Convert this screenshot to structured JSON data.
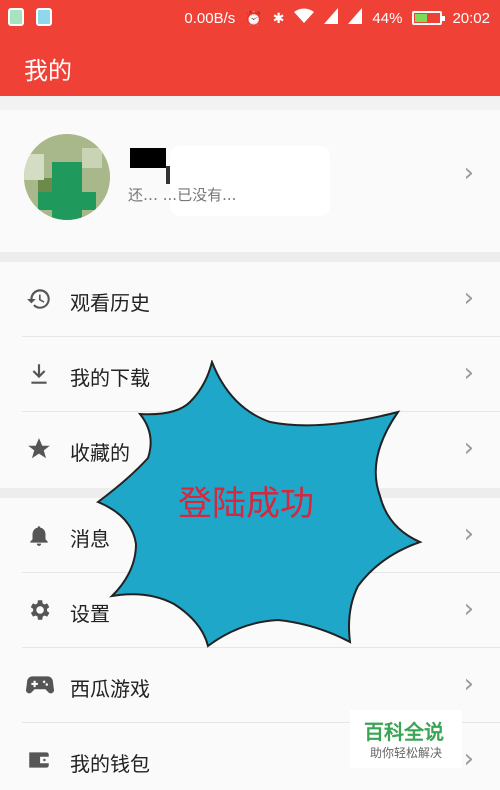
{
  "status_bar": {
    "network_speed": "0.00B/s",
    "battery_percent": "44%",
    "battery_level": 0.44,
    "time": "20:02",
    "icons": [
      "notification-icon",
      "app-icon",
      "alarm-icon",
      "bluetooth-icon",
      "wifi-icon",
      "signal-icon",
      "4g-icon",
      "battery-icon"
    ]
  },
  "header": {
    "title": "我的"
  },
  "profile": {
    "subtext": "还…         ...已没有..."
  },
  "menu": {
    "items": [
      {
        "label": "观看历史",
        "icon": "history-icon"
      },
      {
        "label": "我的下载",
        "icon": "download-icon"
      },
      {
        "label": "收藏的",
        "icon": "star-icon"
      },
      {
        "label": "消息",
        "icon": "bell-icon"
      },
      {
        "label": "设置",
        "icon": "gear-icon"
      },
      {
        "label": "西瓜游戏",
        "icon": "gamepad-icon"
      },
      {
        "label": "我的钱包",
        "icon": "wallet-icon"
      }
    ]
  },
  "overlay": {
    "text": "登陆成功",
    "fill": "#1fa7c9",
    "text_color": "#d7263d"
  },
  "watermark": {
    "title": "百科全说",
    "subtitle": "助你轻松解决"
  },
  "colors": {
    "brand_red": "#ef4136",
    "background": "#f2f2f2"
  }
}
